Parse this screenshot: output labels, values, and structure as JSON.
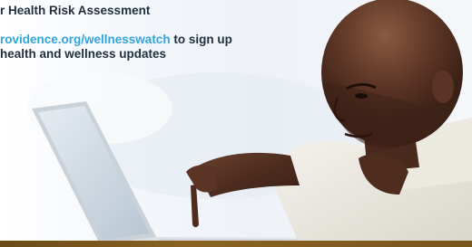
{
  "banner": {
    "heading_line": "r Health Risk Assessment",
    "link_text": "rovidence.org/wellnesswatch",
    "cta_suffix": " to sign up",
    "cta_line2": "health and wellness updates"
  },
  "photo": {
    "subject": "man-pointing-at-laptop-screen"
  },
  "colors": {
    "heading_text": "#1f2f3d",
    "link": "#2fa6da",
    "bottom_bar": "#7a551c"
  }
}
